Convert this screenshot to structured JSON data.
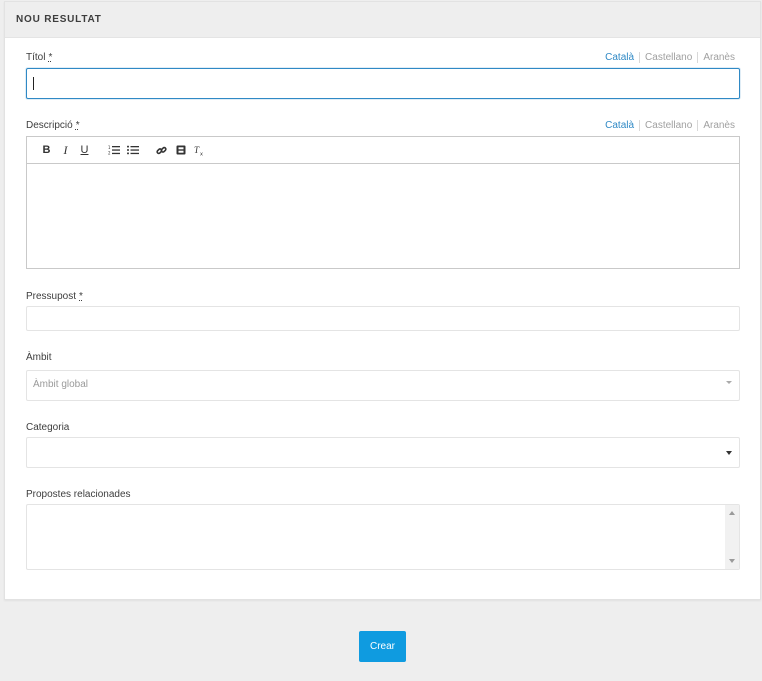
{
  "card": {
    "title": "NOU RESULTAT"
  },
  "languages": [
    "Català",
    "Castellano",
    "Aranès"
  ],
  "fields": {
    "title": {
      "label": "Títol",
      "required_mark": "*",
      "value": ""
    },
    "description": {
      "label": "Descripció",
      "required_mark": "*",
      "value": ""
    },
    "budget": {
      "label": "Pressupost",
      "required_mark": "*",
      "value": ""
    },
    "scope": {
      "label": "Àmbit",
      "selected": "Àmbit global"
    },
    "category": {
      "label": "Categoria",
      "selected": ""
    },
    "related": {
      "label": "Propostes relacionades"
    }
  },
  "editor_toolbar": {
    "bold": "B",
    "italic": "I",
    "underline": "U",
    "clear": "Tx"
  },
  "actions": {
    "create_label": "Crear"
  },
  "colors": {
    "accent": "#2f89c5",
    "primary_button": "#0f9be0"
  }
}
